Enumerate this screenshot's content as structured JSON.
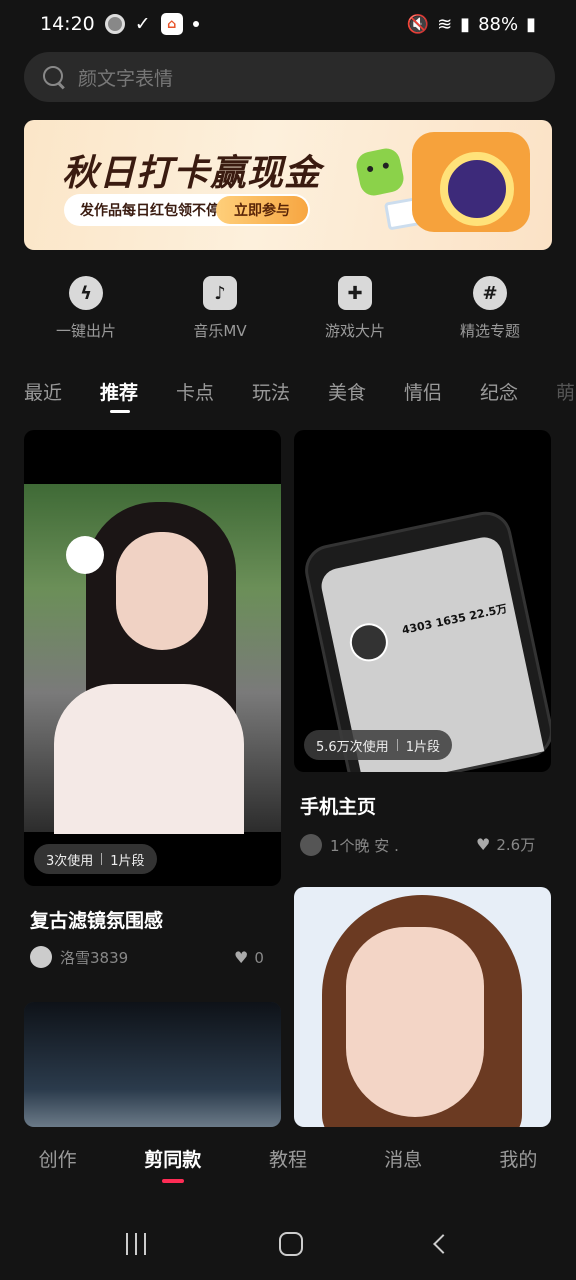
{
  "status_bar": {
    "time": "14:20",
    "battery": "88%"
  },
  "search": {
    "placeholder": "颜文字表情"
  },
  "banner": {
    "title": "秋日打卡赢现金",
    "subtitle": "发作品每日红包领不停",
    "cta": "立即参与"
  },
  "quick_actions": [
    {
      "label": "一键出片",
      "icon": "lightning-icon"
    },
    {
      "label": "音乐MV",
      "icon": "music-note-icon"
    },
    {
      "label": "游戏大片",
      "icon": "gamepad-icon"
    },
    {
      "label": "精选专题",
      "icon": "hashtag-icon"
    }
  ],
  "tabs": [
    "最近",
    "推荐",
    "卡点",
    "玩法",
    "美食",
    "情侣",
    "纪念",
    "萌"
  ],
  "active_tab": "推荐",
  "feed": [
    {
      "usage": "3次使用",
      "segments": "1片段",
      "title": "复古滤镜氛围感",
      "author": "洛雪3839",
      "likes": "0"
    },
    {
      "usage": "5.6万次使用",
      "segments": "1片段",
      "title": "手机主页",
      "author": "1个晚 安 .",
      "likes": "2.6万",
      "phone_screen_nums": "4303   1635   22.5万"
    }
  ],
  "bottom_nav": [
    "创作",
    "剪同款",
    "教程",
    "消息",
    "我的"
  ],
  "active_nav": "剪同款",
  "colors": {
    "accent": "#fe2c55",
    "background": "#141414"
  }
}
